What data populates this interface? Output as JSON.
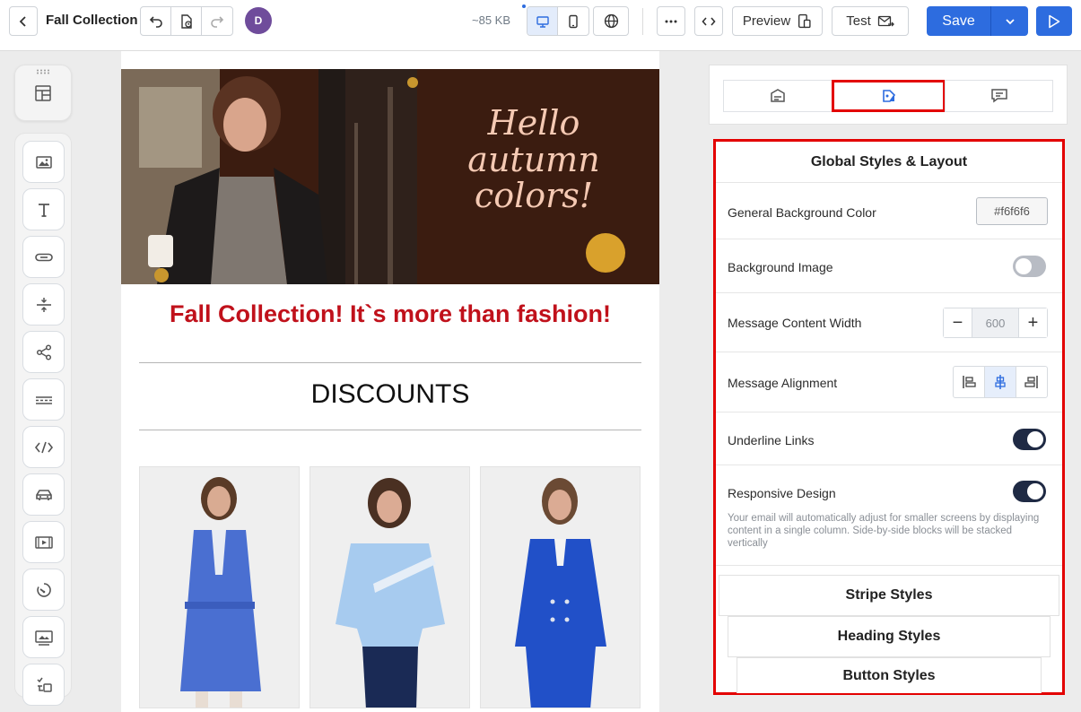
{
  "header": {
    "title": "Fall Collection",
    "avatar_initial": "D",
    "size_label": "~85 KB",
    "preview_label": "Preview",
    "test_label": "Test",
    "save_label": "Save"
  },
  "left_toolbar": {
    "tools": [
      "image-block-icon",
      "text-block-icon",
      "button-block-icon",
      "spacer-block-icon",
      "social-block-icon",
      "divider-block-icon",
      "html-block-icon",
      "menu-block-icon",
      "video-block-icon",
      "timer-block-icon",
      "banner-block-icon",
      "amp-block-icon"
    ]
  },
  "email": {
    "hero_text_line1": "Hello",
    "hero_text_line2": "autumn",
    "hero_text_line3": "colors!",
    "heading": "Fall Collection! It`s more than fashion!",
    "section_title": "DISCOUNTS",
    "colors": {
      "heading": "#c0111b",
      "hero_bg": "#3a1a0e"
    }
  },
  "settings": {
    "title": "Global Styles & Layout",
    "bg_color_label": "General Background Color",
    "bg_color_value": "#f6f6f6",
    "bg_image_label": "Background Image",
    "bg_image_enabled": false,
    "content_width_label": "Message Content Width",
    "content_width_value": "600",
    "alignment_label": "Message Alignment",
    "alignment_selected": "center",
    "underline_label": "Underline Links",
    "underline_enabled": true,
    "responsive_label": "Responsive Design",
    "responsive_enabled": true,
    "responsive_hint": "Your email will automatically adjust for smaller screens by displaying content in a single column. Side-by-side blocks will be stacked vertically",
    "stripe_styles": "Stripe Styles",
    "heading_styles": "Heading Styles",
    "button_styles": "Button Styles"
  },
  "accent_colors": {
    "primary": "#2d6cdf",
    "highlight": "#e30000",
    "toggle_on": "#1f2a44"
  }
}
